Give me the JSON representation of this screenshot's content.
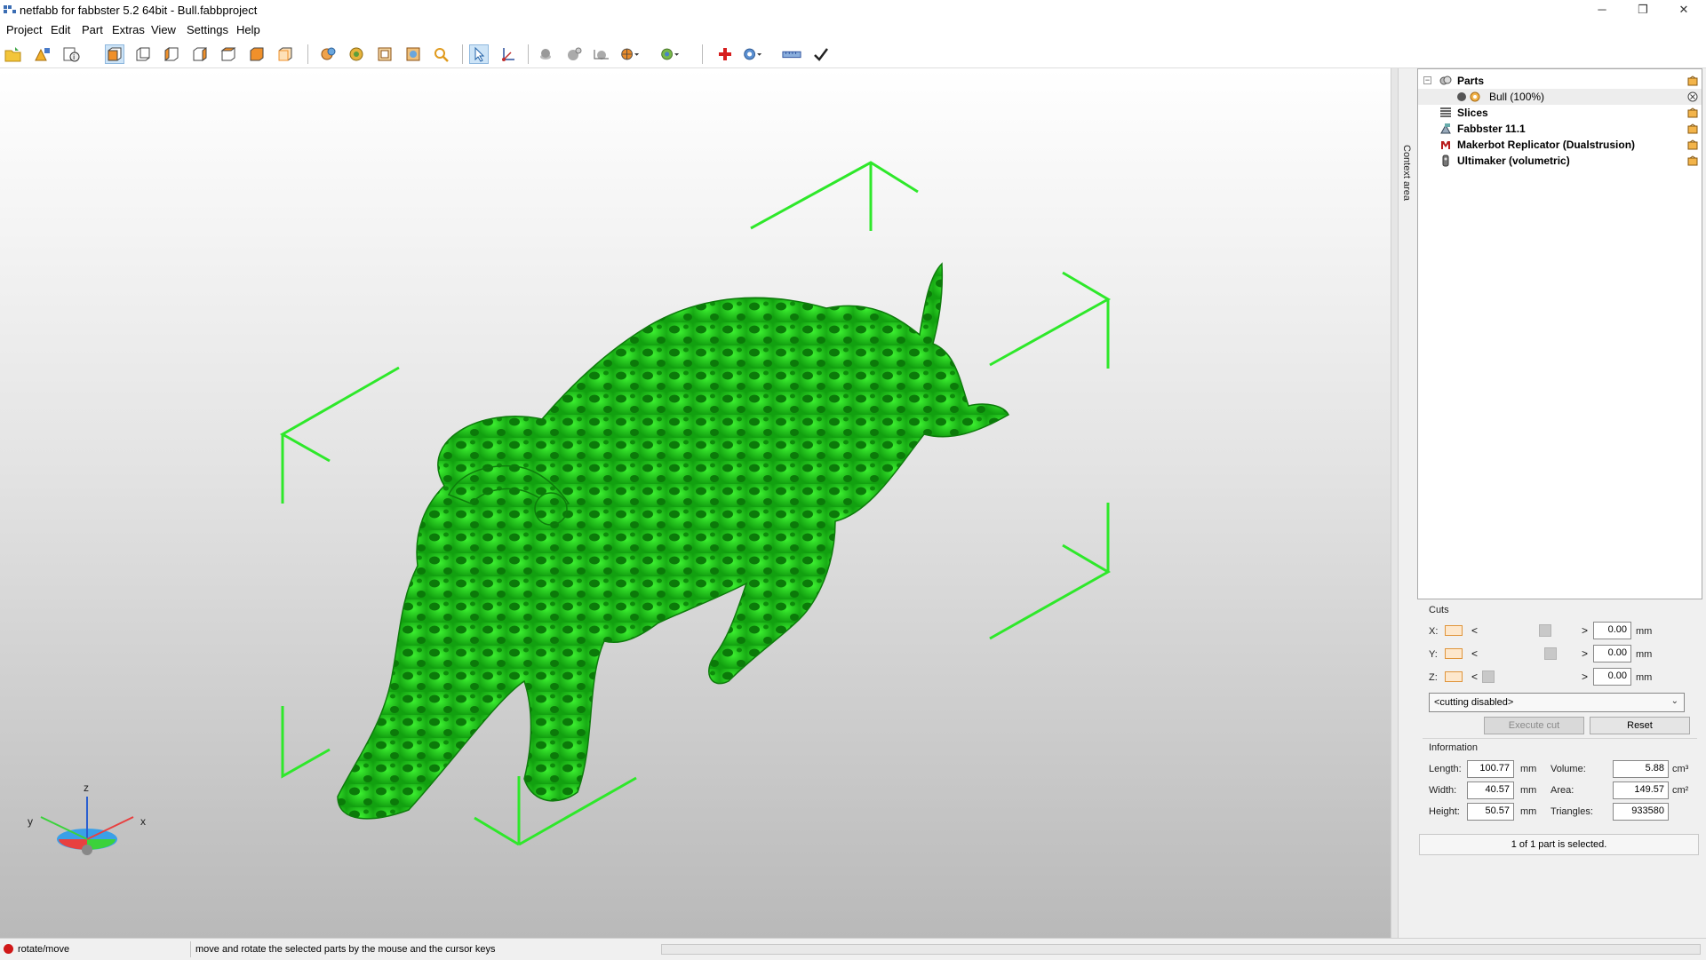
{
  "window": {
    "title": "netfabb for fabbster 5.2 64bit - Bull.fabbproject",
    "minimize_glyph": "─",
    "restore_glyph": "❐",
    "close_glyph": "✕"
  },
  "menu": [
    "Project",
    "Edit",
    "Part",
    "Extras",
    "View",
    "Settings",
    "Help"
  ],
  "toolbar_icons": [
    "open-project-icon",
    "add-part-icon",
    "project-info-icon",
    "view-front-icon",
    "view-back-icon",
    "view-left-icon",
    "view-right-icon",
    "view-top-icon",
    "view-bottom-icon",
    "view-perspective-icon",
    "rotate-icon",
    "pan-icon",
    "zoom-fit-icon",
    "zoom-selection-icon",
    "zoom-icon",
    "select-tool-icon",
    "move-tool-icon",
    "shading-icon",
    "sphere-icon",
    "cut-plane-icon",
    "color-mode-icon",
    "visibility-icon",
    "repair-icon",
    "analysis-icon",
    "measure-icon",
    "check-icon"
  ],
  "viewport": {
    "colors": {
      "mesh": "#22d41a",
      "mesh_dark": "#0f8e0c",
      "bounding_box": "#2ee82a"
    },
    "axes": {
      "x": "x",
      "y": "y",
      "z": "z"
    }
  },
  "side_tab": {
    "label": "Context area"
  },
  "tree": {
    "items": [
      {
        "label": "Parts",
        "bold": true,
        "icon": "parts-icon",
        "level": 0,
        "expander": "−",
        "right_icon": "settings-icon"
      },
      {
        "label": "Bull (100%)",
        "bold": false,
        "icon": "part-mesh-icon",
        "level": 1,
        "selected": true,
        "right_icon": "remove-icon"
      },
      {
        "label": "Slices",
        "bold": true,
        "icon": "slices-icon",
        "level": 0,
        "right_icon": "settings-icon"
      },
      {
        "label": "Fabbster 11.1",
        "bold": true,
        "icon": "machine-icon",
        "level": 0,
        "right_icon": "settings-icon"
      },
      {
        "label": "Makerbot Replicator (Dualstrusion)",
        "bold": true,
        "icon": "makerbot-icon",
        "level": 0,
        "right_icon": "settings-icon"
      },
      {
        "label": "Ultimaker (volumetric)",
        "bold": true,
        "icon": "ultimaker-icon",
        "level": 0,
        "right_icon": "settings-icon"
      }
    ]
  },
  "cuts": {
    "title": "Cuts",
    "rows": [
      {
        "axis": "X:",
        "value": "0.00",
        "unit": "mm",
        "position": 0.52
      },
      {
        "axis": "Y:",
        "value": "0.00",
        "unit": "mm",
        "position": 0.58
      },
      {
        "axis": "Z:",
        "value": "0.00",
        "unit": "mm",
        "position": 0.0
      }
    ],
    "left_arrow": "<",
    "right_arrow": ">",
    "mode": "<cutting disabled>",
    "execute_label": "Execute cut",
    "reset_label": "Reset"
  },
  "information": {
    "title": "Information",
    "length_label": "Length:",
    "length": "100.77",
    "length_unit": "mm",
    "width_label": "Width:",
    "width": "40.57",
    "width_unit": "mm",
    "height_label": "Height:",
    "height": "50.57",
    "height_unit": "mm",
    "volume_label": "Volume:",
    "volume": "5.88",
    "volume_unit": "cm³",
    "area_label": "Area:",
    "area": "149.57",
    "area_unit": "cm²",
    "triangles_label": "Triangles:",
    "triangles": "933580"
  },
  "selection_text": "1 of 1 part is selected.",
  "status": {
    "mode": "rotate/move",
    "message": "move and rotate the selected parts by the mouse and the cursor keys"
  }
}
